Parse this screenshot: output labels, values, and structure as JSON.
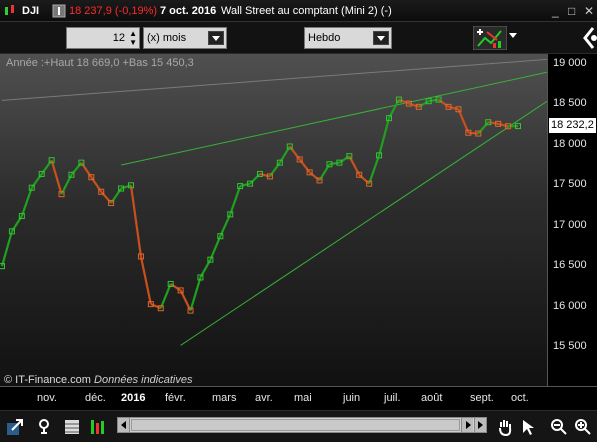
{
  "titlebar": {
    "symbol": "DJI",
    "price_change": "18 237,9 (-0,19%)",
    "date": "7 oct. 2016",
    "title": "Wall Street au comptant (Mini 2) (-)",
    "minimize": "_",
    "maximize": "□",
    "close": "✕"
  },
  "toolbar": {
    "period_value": "12",
    "unit_label": "(x) mois",
    "timeframe": "Hebdo"
  },
  "chart": {
    "annotation": "Année :+Haut 18 669,0 +Bas 15 450,3",
    "watermark_prefix": "© IT-Finance.com",
    "watermark_suffix": "Données indicatives",
    "last_price": "18 232,2"
  },
  "chart_data": {
    "type": "line",
    "style": "weekly line with markers, green rising / orange falling",
    "y_ticks": [
      "19 000",
      "18 500",
      "18 000",
      "17 500",
      "17 000",
      "16 500",
      "16 000",
      "15 500"
    ],
    "ylim": [
      15200,
      19100
    ],
    "x_ticks": [
      "nov.",
      "déc.",
      "2016",
      "févr.",
      "mars",
      "avr.",
      "mai",
      "juin",
      "juil.",
      "août",
      "sept.",
      "oct."
    ],
    "up_color": "#1fa01f",
    "down_color": "#c8501c",
    "x": [
      0,
      1,
      2,
      3,
      4,
      5,
      6,
      7,
      8,
      9,
      10,
      11,
      12,
      13,
      14,
      15,
      16,
      17,
      18,
      19,
      20,
      21,
      22,
      23,
      24,
      25,
      26,
      27,
      28,
      29,
      30,
      31,
      32,
      33,
      34,
      35,
      36,
      37,
      38,
      39,
      40,
      41,
      42,
      43,
      44,
      45,
      46,
      47,
      48,
      49,
      50,
      51,
      52
    ],
    "values": [
      16500,
      16930,
      17120,
      17470,
      17640,
      17810,
      17390,
      17630,
      17780,
      17600,
      17420,
      17280,
      17460,
      17500,
      16620,
      16030,
      15980,
      16280,
      16200,
      15950,
      16360,
      16580,
      16870,
      17140,
      17490,
      17520,
      17640,
      17610,
      17780,
      17980,
      17820,
      17660,
      17560,
      17760,
      17780,
      17860,
      17630,
      17520,
      17870,
      18330,
      18560,
      18510,
      18470,
      18540,
      18560,
      18470,
      18440,
      18150,
      18140,
      18280,
      18260,
      18230,
      18232
    ]
  },
  "trendlines": [
    {
      "color": "#7a7a7a",
      "from": [
        0,
        18550
      ],
      "to": [
        52,
        19030
      ]
    },
    {
      "color": "#39b239",
      "from": [
        12,
        17750
      ],
      "to": [
        52,
        18820
      ]
    },
    {
      "color": "#39b239",
      "from": [
        18,
        15520
      ],
      "to": [
        52,
        18300
      ]
    }
  ],
  "bottombar": {}
}
